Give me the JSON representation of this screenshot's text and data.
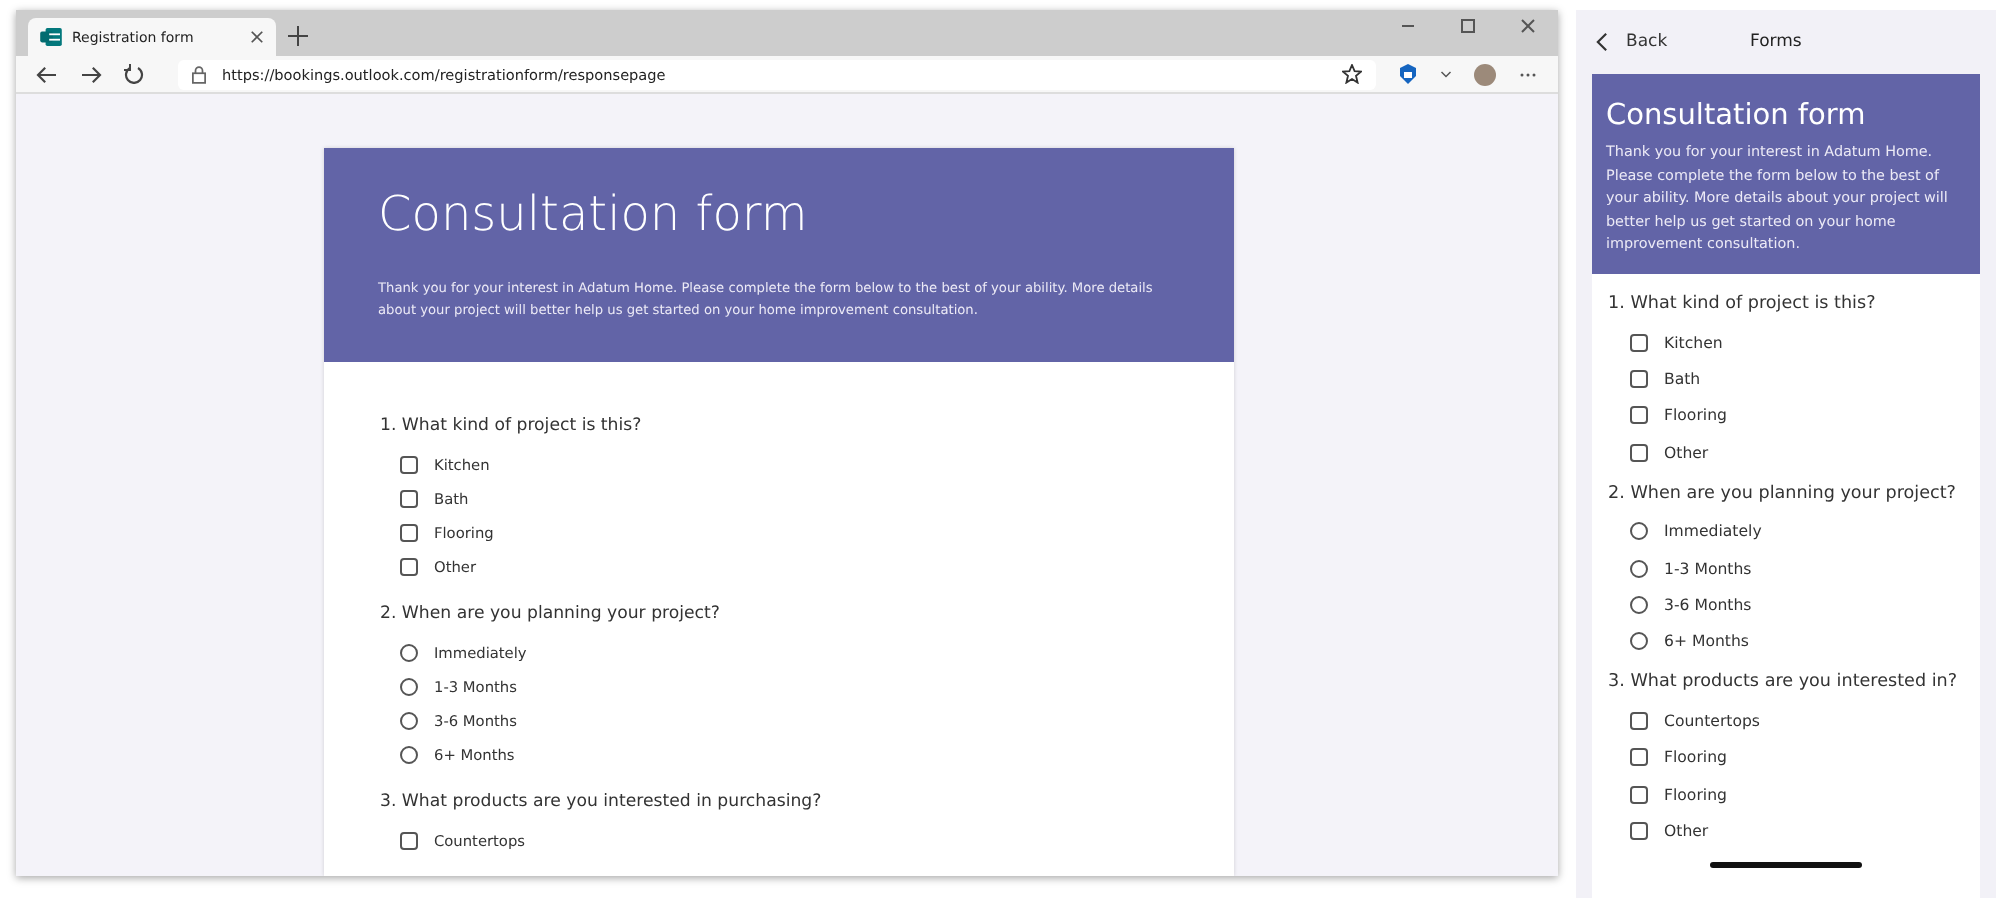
{
  "browser": {
    "tab": {
      "title": "Registration form",
      "selected": true
    },
    "url": "https://bookings.outlook.com/registrationform/responsepage",
    "form": {
      "title": "Consultation form",
      "description": "Thank you for your interest in Adatum Home. Please complete the form below to the best of your ability. More details about your project will better help us get started on your home improvement consultation.",
      "questions": [
        {
          "text": "1. What kind of project is this?",
          "kind": "checkbox",
          "options": [
            {
              "label": "Kitchen",
              "checked": false
            },
            {
              "label": "Bath",
              "checked": false
            },
            {
              "label": "Flooring",
              "checked": false
            },
            {
              "label": "Other",
              "checked": false
            }
          ]
        },
        {
          "text": "2. When are you planning your project?",
          "kind": "radio",
          "options": [
            {
              "label": "Immediately",
              "checked": false
            },
            {
              "label": "1-3 Months",
              "checked": false
            },
            {
              "label": "3-6 Months",
              "checked": false
            },
            {
              "label": "6+ Months",
              "checked": false
            }
          ]
        },
        {
          "text": "3. What products are you interested in purchasing?",
          "kind": "checkbox",
          "options": [
            {
              "label": "Countertops",
              "checked": false
            }
          ]
        }
      ]
    }
  },
  "phone": {
    "back": "Back",
    "title": "Forms",
    "form": {
      "title": "Consultation form",
      "description": "Thank you for your interest in Adatum Home. Please complete the form below to the best of your ability. More details about your project will better help us get started on your home improvement consultation.",
      "questions": [
        {
          "text": "1. What kind of project is this?",
          "kind": "checkbox",
          "options": [
            {
              "label": "Kitchen",
              "checked": false
            },
            {
              "label": "Bath",
              "checked": false
            },
            {
              "label": "Flooring",
              "checked": false
            },
            {
              "label": "Other",
              "checked": false
            }
          ]
        },
        {
          "text": "2. When are you planning your project?",
          "kind": "radio",
          "options": [
            {
              "label": "Immediately",
              "checked": false
            },
            {
              "label": "1-3 Months",
              "checked": false
            },
            {
              "label": "3-6 Months",
              "checked": false
            },
            {
              "label": "6+ Months",
              "checked": false
            }
          ]
        },
        {
          "text": "3. What products are you interested in?",
          "kind": "checkbox",
          "options": [
            {
              "label": "Countertops",
              "checked": false
            },
            {
              "label": "Flooring",
              "checked": false
            },
            {
              "label": "Flooring",
              "checked": false
            },
            {
              "label": "Other",
              "checked": false
            }
          ]
        }
      ]
    }
  }
}
